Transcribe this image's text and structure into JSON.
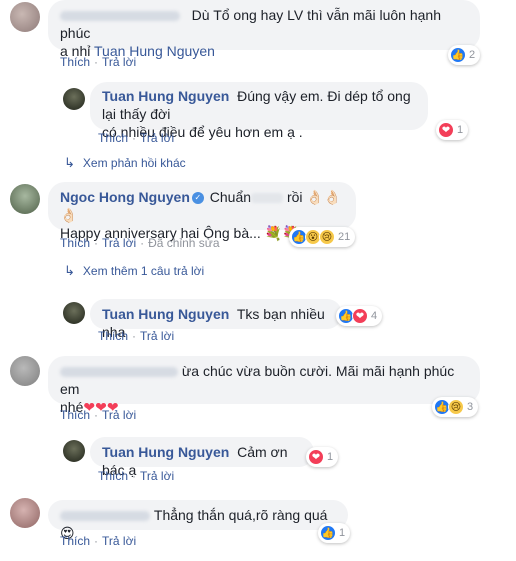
{
  "comments": [
    {
      "id": "c1",
      "text_line1": "Dù Tổ ong hay LV thì vẫn mãi luôn hạnh phúc",
      "text_line2_prefix": "a nhỉ",
      "mention": "Tuan Hung Nguyen",
      "like_label": "Thích",
      "reply_label": "Trả lời",
      "reaction_count": "2"
    },
    {
      "id": "c1r1",
      "author": "Tuan Hung Nguyen",
      "text_line1": "Đúng vậy em. Đi dép tổ ong lại thấy đời",
      "text_line2": "có nhiều điều để yêu hơn em ạ .",
      "like_label": "Thích",
      "reply_label": "Trả lời",
      "reaction_count": "1"
    },
    {
      "id": "c1more",
      "label": "Xem phản hồi khác"
    },
    {
      "id": "c2",
      "author": "Ngoc Hong Nguyen",
      "text_line1_a": "Chuẩn",
      "text_line1_b": "rồi",
      "text_line1_emoji": "👌🏻👌🏻👌🏻",
      "text_line2": "Happy anniversary hai Ông bà...",
      "text_line2_emoji": "💐💐",
      "like_label": "Thích",
      "reply_label": "Trả lời",
      "edited_label": "Đã chỉnh sửa",
      "reaction_count": "21"
    },
    {
      "id": "c2more",
      "label": "Xem thêm 1 câu trả lời"
    },
    {
      "id": "c2r1",
      "author": "Tuan Hung Nguyen",
      "text": "Tks bạn nhiều nha",
      "like_label": "Thích",
      "reply_label": "Trả lời",
      "reaction_count": "4"
    },
    {
      "id": "c3",
      "text_line1": "ừa chúc vừa buồn cười. Mãi mãi hạnh phúc em",
      "text_line2": "nhé",
      "text_line2_emoji": "❤❤❤",
      "like_label": "Thích",
      "reply_label": "Trả lời",
      "reaction_count": "3"
    },
    {
      "id": "c3r1",
      "author": "Tuan Hung Nguyen",
      "text": "Cảm ơn bác ạ",
      "like_label": "Thích",
      "reply_label": "Trả lời",
      "reaction_count": "1"
    },
    {
      "id": "c4",
      "text": "Thẳng thắn quá,rõ ràng quá",
      "text_emoji": "😍",
      "like_label": "Thích",
      "reply_label": "Trả lời",
      "reaction_count": "1"
    }
  ],
  "colors": {
    "link": "#385898",
    "bubble": "#f2f3f5",
    "muted": "#90949c",
    "like": "#2078f4",
    "love": "#f33e58"
  }
}
